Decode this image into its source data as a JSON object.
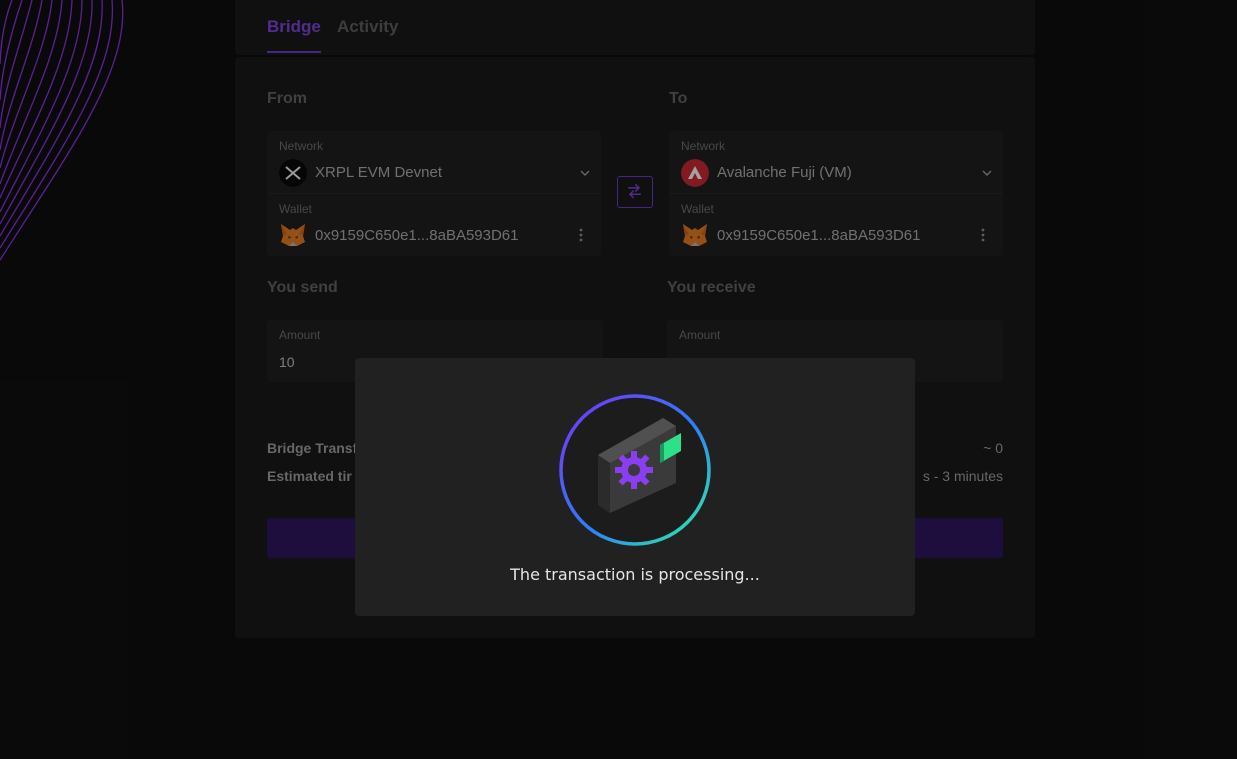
{
  "tabs": [
    {
      "label": "Bridge",
      "active": true
    },
    {
      "label": "Activity",
      "active": false
    }
  ],
  "from": {
    "title": "From",
    "network_label": "Network",
    "network": "XRPL EVM Devnet",
    "network_icon": "xrpl-logo-icon",
    "wallet_label": "Wallet",
    "wallet": "0x9159C650e1...8aBA593D61"
  },
  "to": {
    "title": "To",
    "network_label": "Network",
    "network": "Avalanche Fuji (VM)",
    "network_icon": "avalanche-logo-icon",
    "wallet_label": "Wallet",
    "wallet": "0x9159C650e1...8aBA593D61"
  },
  "send": {
    "title": "You send",
    "amount_label": "Amount",
    "amount": "10"
  },
  "receive": {
    "title": "You receive",
    "amount_label": "Amount"
  },
  "info": {
    "fee_label": "Bridge Transf",
    "fee_value": "~ 0",
    "time_label": "Estimated tir",
    "time_value": "s - 3 minutes"
  },
  "modal": {
    "message": "The transaction is processing...",
    "icon": "processing-wallet-gear-icon"
  },
  "colors": {
    "accent": "#6d32c9",
    "background": "#0a0a0a",
    "card": "#141414",
    "modal": "#212121"
  }
}
